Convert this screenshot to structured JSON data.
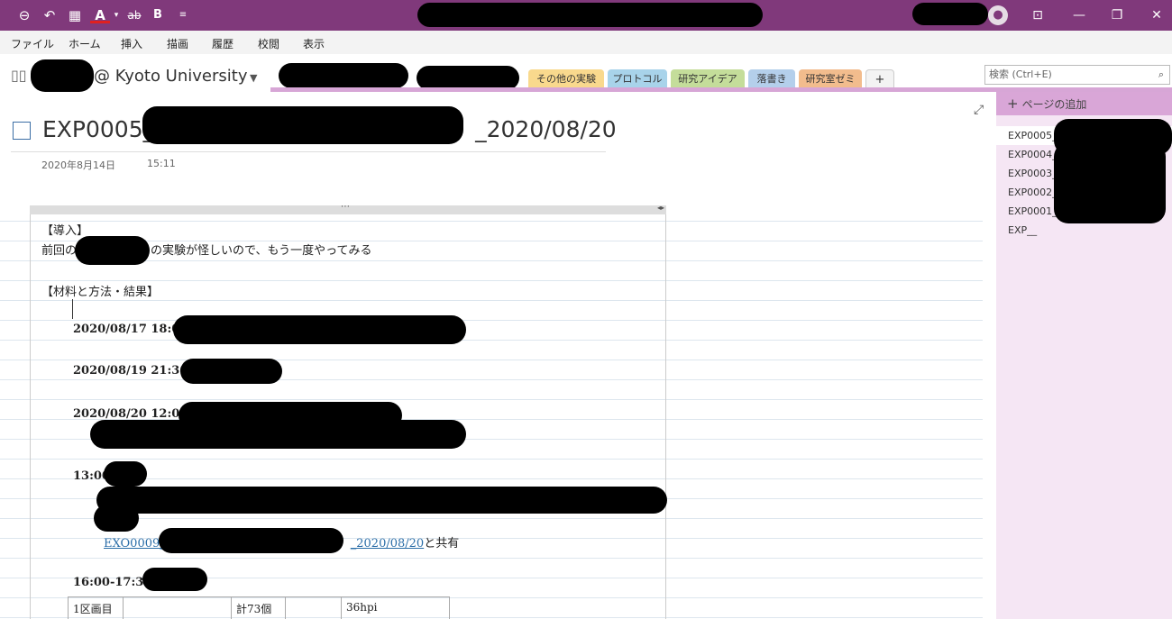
{
  "quick_access": {
    "back_icon": "back-circle-icon",
    "undo_icon": "undo-icon",
    "calendar_icon": "calendar-icon",
    "font_color_label": "A",
    "strike_label": "ab",
    "bold_label": "B",
    "more_icon": "chevron-down-icon"
  },
  "menu": [
    "ファイル",
    "ホーム",
    "挿入",
    "描画",
    "履歴",
    "校閲",
    "表示"
  ],
  "notebook": {
    "name": "@ Kyoto University"
  },
  "sections": [
    {
      "label": "その他の実験",
      "color": "#f9d98d"
    },
    {
      "label": "プロトコル",
      "color": "#a8d3ea"
    },
    {
      "label": "研究アイデア",
      "color": "#c4dd9a"
    },
    {
      "label": "落書き",
      "color": "#b4cfeb"
    },
    {
      "label": "研究室ゼミ",
      "color": "#f2bc8d"
    },
    {
      "label": "+",
      "color": "#f3f3f3"
    }
  ],
  "search": {
    "placeholder": "検索 (Ctrl+E)"
  },
  "page": {
    "title_prefix": "EXP0005_",
    "title_suffix": "_2020/08/20",
    "date": "2020年8月14日",
    "time": "15:11"
  },
  "notes": {
    "intro_heading": "【導入】",
    "intro_prefix": "前回の",
    "intro_suffix": "の実験が怪しいので、もう一度やってみる",
    "methods_heading": "【材料と方法・結果】",
    "entry1": "2020/08/17 18:00",
    "entry2": "2020/08/19 21:30",
    "entry3": "2020/08/20 12:00",
    "entry4": "13:00",
    "link_prefix": "EXO0009_",
    "link_suffix": "_2020/08/20",
    "link_tail": "と共有",
    "entry5": "16:00-17:30"
  },
  "table": {
    "cells": [
      "1区画目",
      "",
      "計73個",
      "",
      "36hpi"
    ]
  },
  "pages_pane": {
    "add_label": "ページの追加",
    "items": [
      "EXP0005_",
      "EXP0004_",
      "EXP0003_",
      "EXP0002_",
      "EXP0001_",
      "EXP__"
    ]
  },
  "colors": {
    "title_bar": "#80397b",
    "pane": "#f5e6f4",
    "accent": "#d9a6d7"
  }
}
